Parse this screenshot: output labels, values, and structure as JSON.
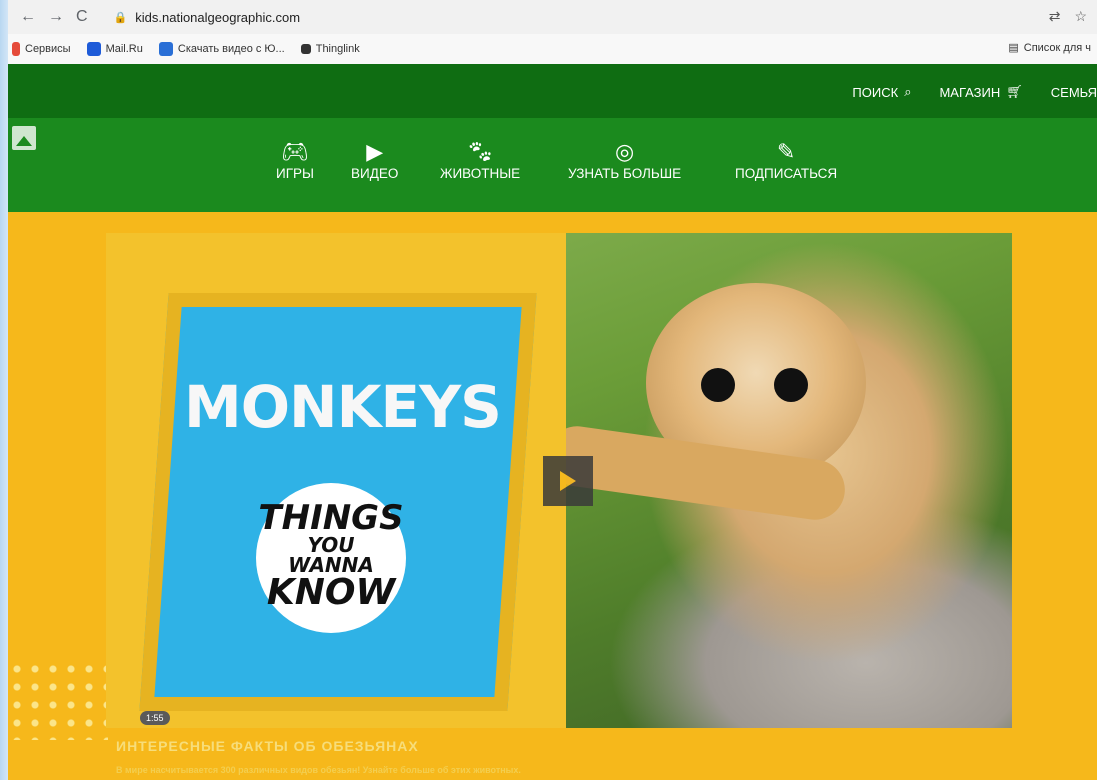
{
  "browser": {
    "url": "kids.nationalgeographic.com",
    "bookmarks": [
      {
        "label": "Сервисы",
        "icon": "apps-icon",
        "color": "#e54b3a"
      },
      {
        "label": "Mail.Ru",
        "icon": "mailru-icon",
        "color": "#1e5bd8"
      },
      {
        "label": "Скачать видео с Ю...",
        "icon": "download-icon",
        "color": "#2a6fd6"
      },
      {
        "label": "Thinglink",
        "icon": "thinglink-icon",
        "color": "#333333"
      }
    ],
    "reading_list": "Список для ч"
  },
  "header": {
    "search_label": "ПОИСК",
    "shop_label": "МАГАЗИН",
    "family_label": "СЕМЬЯ"
  },
  "nav": {
    "items": [
      {
        "label": "ИГРЫ",
        "icon": "gamepad-icon"
      },
      {
        "label": "ВИДЕО",
        "icon": "play-circle-icon"
      },
      {
        "label": "ЖИВОТНЫЕ",
        "icon": "paw-icon"
      },
      {
        "label": "УЗНАТЬ БОЛЬШЕ",
        "icon": "target-icon"
      },
      {
        "label": "ПОДПИСАТЬСЯ",
        "icon": "edit-icon"
      }
    ]
  },
  "hero": {
    "title": "MONKEYS",
    "badge_line1": "THINGS",
    "badge_line2": "YOU",
    "badge_line3": "WANNA",
    "badge_line4": "KNOW",
    "duration": "1:55"
  },
  "caption": {
    "title": "ИНТЕРЕСНЫЕ ФАКТЫ ОБ ОБЕЗЬЯНАХ",
    "text": "В мире насчитывается 300 различных видов обезьян! Узнайте больше об этих животных."
  },
  "colors": {
    "header_dark": "#0f6d12",
    "nav_green": "#1b8a1e",
    "page_yellow": "#f6b81b",
    "frame_blue": "#2fb2e6"
  }
}
